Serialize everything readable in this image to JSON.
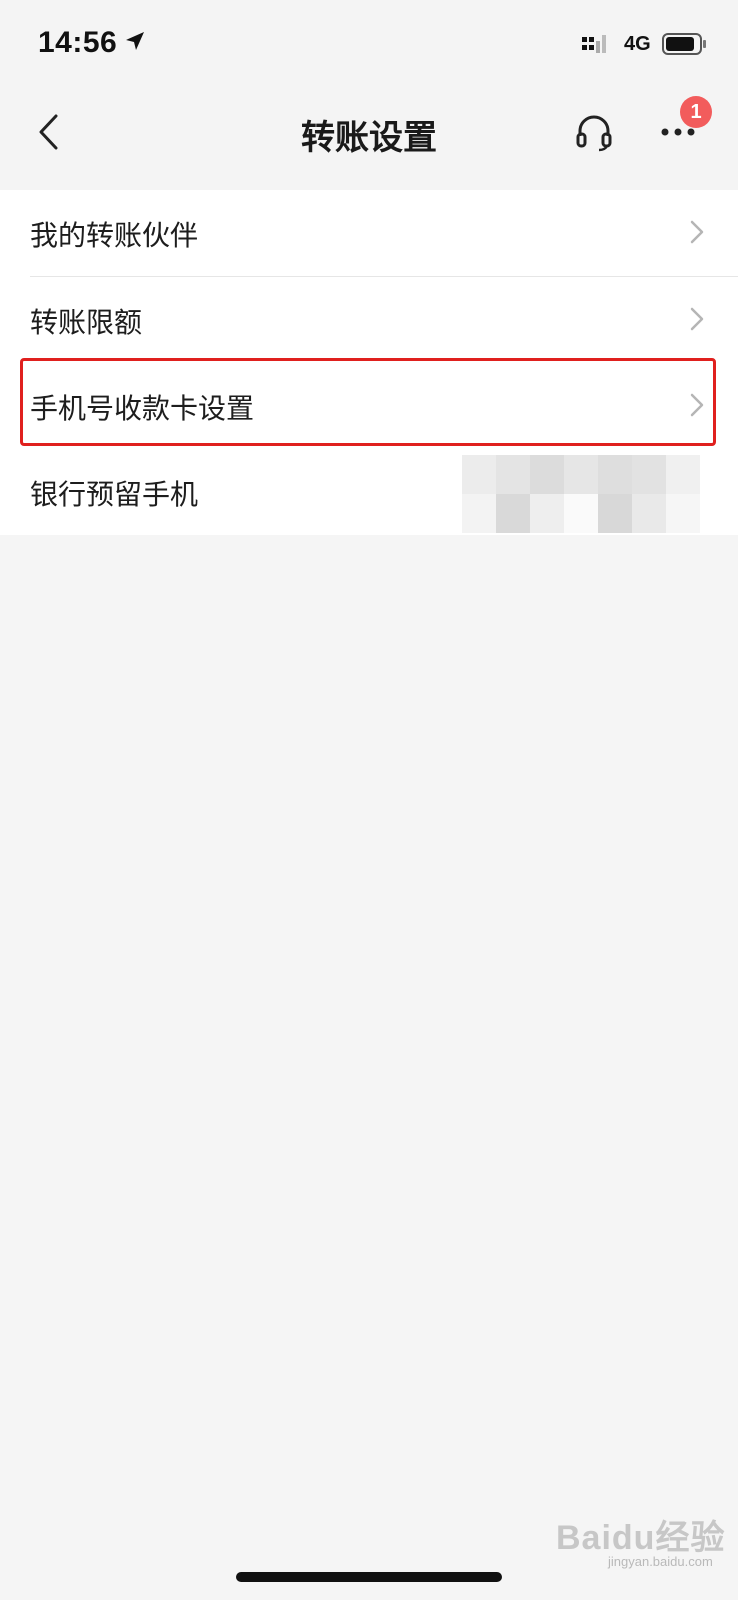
{
  "status_bar": {
    "time": "14:56",
    "network": "4G"
  },
  "header": {
    "title": "转账设置",
    "badge_count": "1"
  },
  "menu": {
    "items": [
      {
        "label": "我的转账伙伴"
      },
      {
        "label": "转账限额"
      },
      {
        "label": "手机号收款卡设置"
      },
      {
        "label": "银行预留手机"
      }
    ]
  },
  "watermark": {
    "brand": "Baidu经验",
    "url": "jingyan.baidu.com"
  },
  "colors": {
    "highlight": "#e0201e",
    "badge": "#f25c5c",
    "background": "#f5f5f5"
  },
  "icons": [
    "location-arrow-icon",
    "signal-icon",
    "battery-icon",
    "back-icon",
    "headset-icon",
    "more-icon",
    "chevron-right-icon"
  ]
}
